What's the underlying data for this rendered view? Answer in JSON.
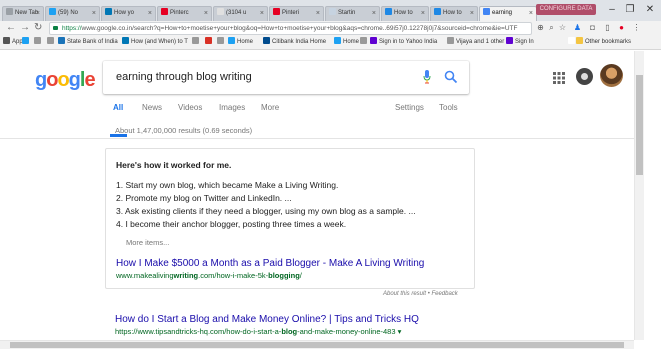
{
  "browser": {
    "tabs": [
      {
        "label": "New Tab",
        "color": "#9aa0a6"
      },
      {
        "label": "(59) No",
        "color": "#1da1f2"
      },
      {
        "label": "How yo",
        "color": "#0077b5"
      },
      {
        "label": "Pinterc",
        "color": "#e60023"
      },
      {
        "label": "(3104 u",
        "color": "#e0e0e0"
      },
      {
        "label": "Pinteri",
        "color": "#e60023"
      },
      {
        "label": "Startin",
        "color": "#c7d3e0"
      },
      {
        "label": "How to",
        "color": "#1e88e5"
      },
      {
        "label": "How to",
        "color": "#1e88e5"
      },
      {
        "label": "earning",
        "color": "#4285f4",
        "active": true
      }
    ],
    "profile_chip": "CONFIGURE DATA",
    "window_controls": {
      "minimize": "–",
      "restore": "❐",
      "close": "✕"
    },
    "url_prefix": "https://",
    "url": "www.google.co.in/search?q=How+to+moetise+your+blog&oq=How+to+moetise+your+blog&aqs=chrome..69i57j0.12278j0j7&sourceid=chrome&ie=UTF",
    "bookmarks": [
      {
        "label": "Apps",
        "color": "#555"
      },
      {
        "label": "",
        "color": "#1da1f2"
      },
      {
        "label": "",
        "color": "#999"
      },
      {
        "label": "",
        "color": "#999"
      },
      {
        "label": "State Bank of India",
        "color": "#1a73b8"
      },
      {
        "label": "How (and When) to T",
        "color": "#0077b5"
      },
      {
        "label": "",
        "color": "#999"
      },
      {
        "label": "",
        "color": "#d93025"
      },
      {
        "label": "",
        "color": "#999"
      },
      {
        "label": "Home",
        "color": "#1da1f2"
      },
      {
        "label": "Citibank India Home",
        "color": "#004b8d"
      },
      {
        "label": "Home",
        "color": "#1da1f2"
      },
      {
        "label": "",
        "color": "#999"
      },
      {
        "label": "Sign in to Yahoo India",
        "color": "#5f01d1"
      },
      {
        "label": "Vijaya and 1 other se",
        "color": "#999"
      },
      {
        "label": "Sign In",
        "color": "#5f01d1"
      },
      {
        "label": "»",
        "color": "#fff"
      },
      {
        "label": "Other bookmarks",
        "color": "#f4c542"
      }
    ]
  },
  "google": {
    "logo_letters": [
      "g",
      "o",
      "o",
      "g",
      "l",
      "e"
    ],
    "logo_colors": [
      "#4285f4",
      "#ea4335",
      "#fbbc05",
      "#4285f4",
      "#34a853",
      "#ea4335"
    ],
    "query": "earning through blog writing",
    "tabs": [
      "All",
      "News",
      "Videos",
      "Images",
      "More"
    ],
    "tools": [
      "Settings",
      "Tools"
    ],
    "result_count": "About 1,47,00,000 results (0.69 seconds)"
  },
  "snippet": {
    "heading": "Here's how it worked for me.",
    "items": [
      "1. Start my own blog, which became Make a Living Writing.",
      "2. Promote my blog on Twitter and LinkedIn. ...",
      "3. Ask existing clients if they need a blogger, using my own blog as a sample. ...",
      "4. I become their anchor blogger, posting three times a week."
    ],
    "more_items": "More items...",
    "title": "How I Make $5000 a Month as a Paid Blogger - Make A Living Writing",
    "url_a": "www.makealiving",
    "url_b": "writing",
    "url_c": ".com/how-i-make-5k-",
    "url_d": "blogging",
    "url_e": "/",
    "about": "About this result • Feedback"
  },
  "result2": {
    "title": "How do I Start a Blog and Make Money Online? | Tips and Tricks HQ",
    "url_a": "https://www.tipsandtricks-hq.com/how-do-i-start-a-",
    "url_b": "blog",
    "url_c": "-and-make-money-online-483 ▾"
  }
}
